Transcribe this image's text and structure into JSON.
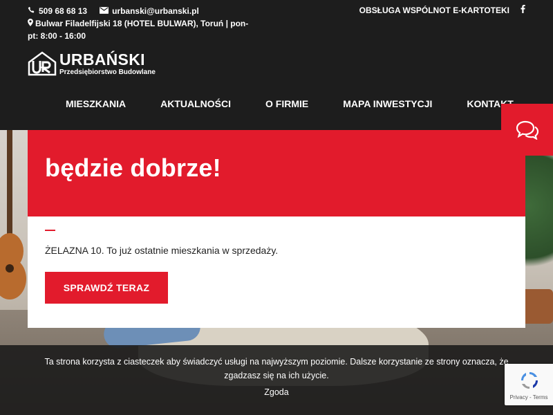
{
  "header": {
    "phone": "509 68 68 13",
    "email": "urbanski@urbanski.pl",
    "address": "Bulwar Filadelfijski 18 (HOTEL BULWAR), Toruń | pon-pt: 8:00 - 16:00",
    "top_link": "OBSŁUGA WSPÓLNOT E-KARTOTEKI",
    "icons": {
      "phone": "phone-icon",
      "email": "envelope-icon",
      "address": "map-pin-icon",
      "social": "facebook-icon"
    }
  },
  "logo": {
    "title": "URBAŃSKI",
    "subtitle": "Przedsiębiorstwo Budowlane"
  },
  "nav": {
    "items": [
      {
        "label": "MIESZKANIA"
      },
      {
        "label": "AKTUALNOŚCI"
      },
      {
        "label": "O FIRMIE"
      },
      {
        "label": "MAPA INWESTYCJI"
      },
      {
        "label": "KONTAKT"
      }
    ]
  },
  "chat": {
    "icon": "chat-bubbles-icon"
  },
  "hero_card": {
    "title": "będzie dobrze!",
    "description": "ŻELAZNA 10. To już ostatnie mieszkania w sprzedaży.",
    "cta_label": "SPRAWDŹ TERAZ"
  },
  "cookie": {
    "message": "Ta strona korzysta z ciasteczek aby świadczyć usługi na najwyższym poziomie. Dalsze korzystanie ze strony oznacza, że zgadzasz się na ich użycie.",
    "accept_label": "Zgoda",
    "close_icon": "close-icon"
  },
  "recaptcha": {
    "links": "Privacy - Terms"
  },
  "colors": {
    "accent": "#e21b2c",
    "header_bg": "#1d1d1d",
    "text_dark": "#222222"
  }
}
